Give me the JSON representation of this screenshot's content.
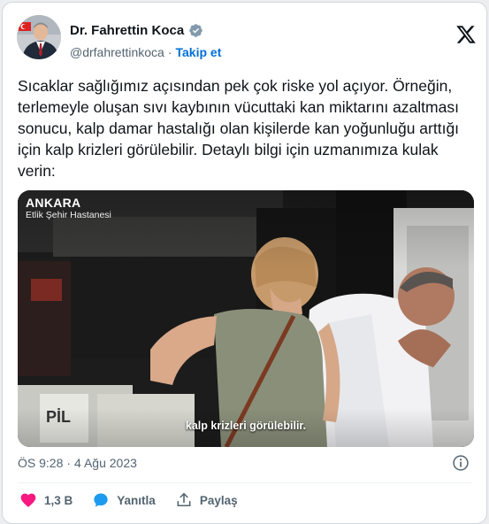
{
  "author": {
    "name": "Dr. Fahrettin Koca",
    "handle": "@drfahrettinkoca",
    "separator": "·",
    "follow_label": "Takip et"
  },
  "tweet": {
    "text": "Sıcaklar sağlığımız açısından pek çok riske yol açıyor. Örneğin, terlemeyle oluşan sıvı kaybının vücuttaki kan miktarını azaltması sonucu, kalp damar hastalığı olan kişilerde kan yoğunluğu arttığı için kalp krizleri görülebilir. Detaylı bilgi için uzmanımıza kulak verin:"
  },
  "media": {
    "location_title": "ANKARA",
    "location_subtitle": "Etlik Şehir Hastanesi",
    "caption": "kalp krizleri görülebilir."
  },
  "meta": {
    "time": "ÖS 9:28",
    "separator": "·",
    "date": "4 Ağu 2023"
  },
  "actions": {
    "like_count": "1,3 B",
    "reply_label": "Yanıtla",
    "share_label": "Paylaş"
  },
  "colors": {
    "accent": "#006fd6",
    "like": "#f91880",
    "reply": "#1d9bf0",
    "muted": "#536471"
  },
  "icons": {
    "verified": "verified-badge-icon",
    "brand": "x-logo-icon",
    "info": "info-icon",
    "like": "heart-icon",
    "reply": "speech-bubble-icon",
    "share": "share-icon"
  }
}
